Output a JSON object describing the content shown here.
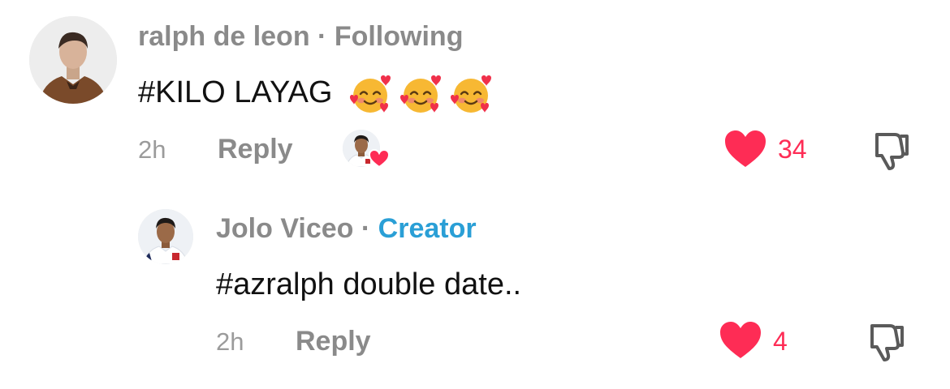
{
  "comments": [
    {
      "username": "ralph de leon",
      "separator": "·",
      "tag": "Following",
      "text": "#KILO LAYAG",
      "emoji_icon": "smiling-face-with-hearts",
      "time": "2h",
      "reply_label": "Reply",
      "likes": "34",
      "liked_by_creator": true
    },
    {
      "username": "Jolo Viceo",
      "separator": "·",
      "tag": "Creator",
      "text": "#azralph double date..",
      "time": "2h",
      "reply_label": "Reply",
      "likes": "4"
    }
  ],
  "colors": {
    "like": "#fe2c55",
    "creator_tag": "#2a9fd6",
    "meta_text": "#8a8a8a"
  }
}
